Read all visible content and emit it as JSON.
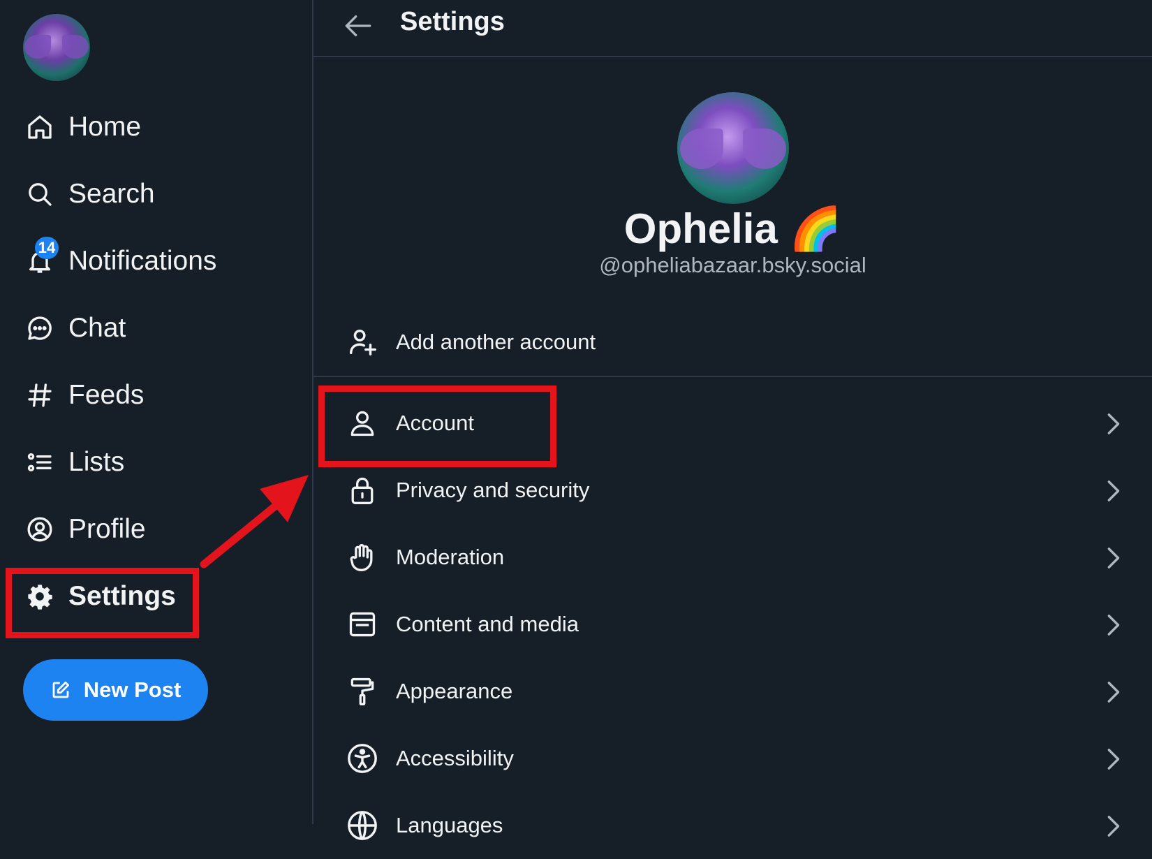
{
  "sidebar": {
    "nav": [
      {
        "label": "Home",
        "icon": "home-icon"
      },
      {
        "label": "Search",
        "icon": "search-icon"
      },
      {
        "label": "Notifications",
        "icon": "bell-icon",
        "badge": "14"
      },
      {
        "label": "Chat",
        "icon": "chat-icon"
      },
      {
        "label": "Feeds",
        "icon": "hash-icon"
      },
      {
        "label": "Lists",
        "icon": "list-icon"
      },
      {
        "label": "Profile",
        "icon": "user-circle-icon"
      },
      {
        "label": "Settings",
        "icon": "gear-icon",
        "active": true
      }
    ],
    "new_post_label": "New Post"
  },
  "header": {
    "title": "Settings"
  },
  "profile": {
    "name": "Ophelia 🌈",
    "handle": "@opheliabazaar.bsky.social"
  },
  "add_account_label": "Add another account",
  "settings_items": [
    {
      "label": "Account",
      "icon": "person-icon"
    },
    {
      "label": "Privacy and security",
      "icon": "lock-icon"
    },
    {
      "label": "Moderation",
      "icon": "hand-icon"
    },
    {
      "label": "Content and media",
      "icon": "window-icon"
    },
    {
      "label": "Appearance",
      "icon": "paint-roller-icon"
    },
    {
      "label": "Accessibility",
      "icon": "accessibility-icon"
    },
    {
      "label": "Languages",
      "icon": "globe-icon"
    }
  ],
  "colors": {
    "background": "#161e27",
    "accent": "#1d83f0",
    "annotation": "#e3141b"
  }
}
